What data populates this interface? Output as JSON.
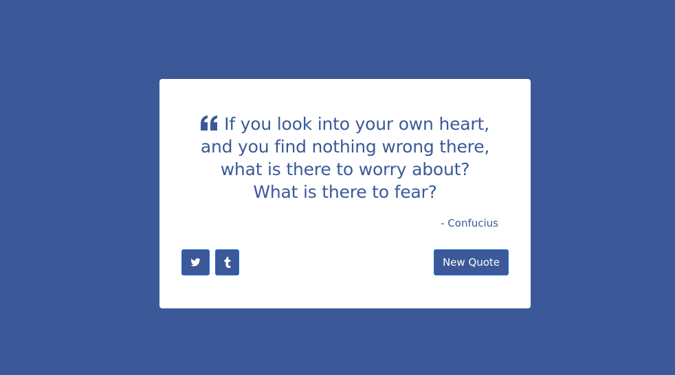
{
  "quote": {
    "lines": [
      "If you look into your own heart,",
      "and you find nothing wrong there,",
      "what is there to worry about?",
      "What is there to fear?"
    ],
    "author": "- Confucius"
  },
  "actions": {
    "twitter_icon": "twitter-icon",
    "tumblr_icon": "tumblr-icon",
    "new_quote_label": "New Quote"
  },
  "colors": {
    "background": "#3b5998",
    "card": "#ffffff",
    "accent": "#3b5998",
    "button_border": "#1f6fd6"
  }
}
